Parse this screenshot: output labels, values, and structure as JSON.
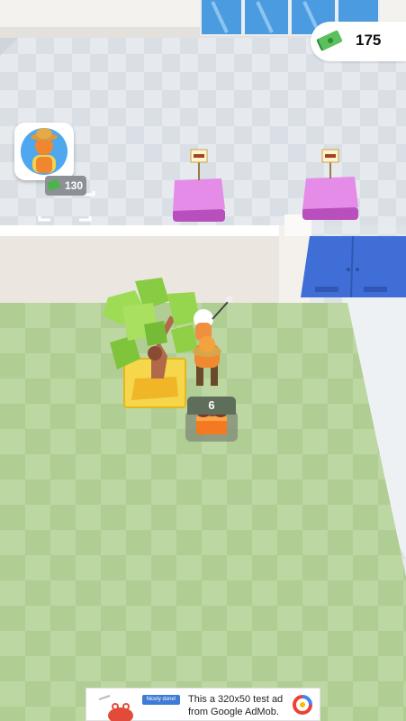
{
  "hud": {
    "money_value": "175",
    "money_icon": "cash-stack-icon"
  },
  "hire_card": {
    "icon": "worker-avatar-icon",
    "price": "130",
    "check_icon": "checkmark-icon"
  },
  "player": {
    "carried_count": "6"
  },
  "stations": {
    "sign_icon": "meat-skewer-sign-icon"
  },
  "ad_banner": {
    "text": "This a 320x50 test ad from Google AdMob.",
    "badge": "Nicely done!"
  },
  "colors": {
    "floor_indoor": "#e3e8ec",
    "grass": "#b9d59f",
    "counter": "#e58be8",
    "door": "#3f6fd6",
    "wall": "#ede7e2",
    "dirt": "#f2c53d"
  }
}
